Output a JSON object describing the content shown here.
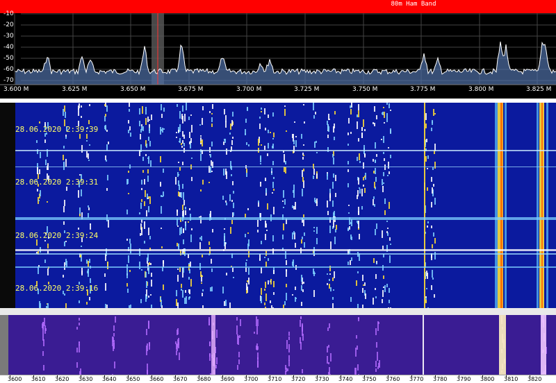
{
  "band_label": "80m Ham Band",
  "spectrum": {
    "y_labels": [
      "-10",
      "-20",
      "-30",
      "-40",
      "-50",
      "-60",
      "-70"
    ],
    "x_labels": [
      "3.600 M",
      "3.625 M",
      "3.650 M",
      "3.675 M",
      "3.700 M",
      "3.725 M",
      "3.750 M",
      "3.775 M",
      "3.800 M",
      "3.825 M"
    ],
    "trace_color": "#ffffff",
    "fill_color": "#4e6fa6",
    "marker_color": "#ff3333"
  },
  "waterfall": {
    "timestamps": [
      "28.06.2020 2:39:39",
      "28.06.2020 2:39:31",
      "28.06.2020 2:39:24",
      "28.06.2020 2:39:16"
    ],
    "background": "#0b1a9e",
    "timestamp_color": "#ffff66"
  },
  "waterfall2": {
    "background": "#3a1c93",
    "axis_labels": [
      "3600",
      "3610",
      "3620",
      "3630",
      "3640",
      "3650",
      "3660",
      "3670",
      "3680",
      "3690",
      "3700",
      "3710",
      "3720",
      "3730",
      "3740",
      "3750",
      "3760",
      "3770",
      "3780",
      "3790",
      "3800",
      "3810",
      "3820"
    ]
  }
}
